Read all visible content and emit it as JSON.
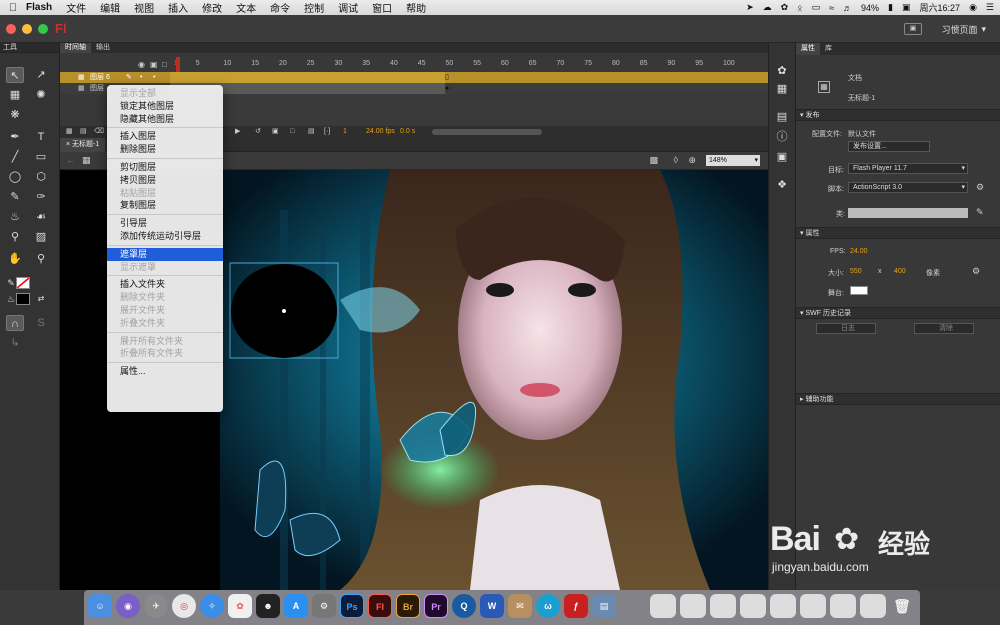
{
  "menubar": {
    "app_name": "Flash",
    "items": [
      "文件",
      "编辑",
      "视图",
      "插入",
      "修改",
      "文本",
      "命令",
      "控制",
      "调试",
      "窗口",
      "帮助"
    ],
    "battery": "94%",
    "clock": "周六16:27"
  },
  "titlebar": {
    "logo": "Fl",
    "workspace": "习惯页面"
  },
  "tools": {
    "header": "工具"
  },
  "timeline": {
    "tabs": [
      "时间轴",
      "输出"
    ],
    "ruler_labels": [
      "1",
      "5",
      "10",
      "15",
      "20",
      "25",
      "30",
      "35",
      "40",
      "45",
      "50",
      "55",
      "60",
      "65",
      "70",
      "75",
      "80",
      "85",
      "90",
      "95",
      "100"
    ],
    "layers": [
      {
        "name": "图层 6"
      },
      {
        "name": "图层"
      }
    ],
    "footer": {
      "frame": "1",
      "fps": "24.00 fps",
      "seconds": "0.0 s"
    }
  },
  "document": {
    "tab": "无标题-1",
    "zoom": "148%"
  },
  "context_menu": {
    "items": [
      {
        "label": "显示全部",
        "disabled": true
      },
      {
        "label": "锁定其他图层",
        "disabled": false
      },
      {
        "label": "隐藏其他图层",
        "disabled": false
      },
      {
        "sep": true
      },
      {
        "label": "插入图层",
        "disabled": false
      },
      {
        "label": "删除图层",
        "disabled": false
      },
      {
        "sep": true
      },
      {
        "label": "剪切图层",
        "disabled": false
      },
      {
        "label": "拷贝图层",
        "disabled": false
      },
      {
        "label": "粘贴图层",
        "disabled": true
      },
      {
        "label": "复制图层",
        "disabled": false
      },
      {
        "sep": true
      },
      {
        "label": "引导层",
        "disabled": false
      },
      {
        "label": "添加传统运动引导层",
        "disabled": false
      },
      {
        "sep": true
      },
      {
        "label": "遮罩层",
        "disabled": false,
        "highlight": true
      },
      {
        "label": "显示遮罩",
        "disabled": true
      },
      {
        "sep": true
      },
      {
        "label": "插入文件夹",
        "disabled": false
      },
      {
        "label": "删除文件夹",
        "disabled": true
      },
      {
        "label": "展开文件夹",
        "disabled": true
      },
      {
        "label": "折叠文件夹",
        "disabled": true
      },
      {
        "sep": true
      },
      {
        "label": "展开所有文件夹",
        "disabled": true
      },
      {
        "label": "折叠所有文件夹",
        "disabled": true
      },
      {
        "sep": true
      },
      {
        "label": "属性...",
        "disabled": false
      }
    ]
  },
  "properties": {
    "tabs": [
      "属性",
      "库"
    ],
    "doc_type": "文档",
    "doc_name": "无标题-1",
    "publish": {
      "section": "发布",
      "profile_label": "配置文件:",
      "profile_value": "默认文件",
      "settings_button": "发布设置...",
      "target_label": "目标:",
      "target_value": "Flash Player 11.7",
      "script_label": "脚本:",
      "script_value": "ActionScript 3.0",
      "class_label": "类:"
    },
    "attributes": {
      "section": "属性",
      "fps_label": "FPS:",
      "fps_value": "24.00",
      "size_label": "大小:",
      "width": "550",
      "x": "x",
      "height": "400",
      "unit": "像素",
      "stage_label": "舞台:"
    },
    "swf_history": {
      "section": "SWF 历史记录",
      "log_button": "日志",
      "clear_button": "清除"
    },
    "accessibility": {
      "section": "辅助功能"
    }
  },
  "watermark": {
    "brand": "Bai",
    "brand2": "经验",
    "url": "jingyan.baidu.com"
  },
  "dock": {
    "labels": [
      "Ps",
      "Fl",
      "Br",
      "Pr",
      "W"
    ]
  },
  "colors": {
    "highlight": "#1f5ed8",
    "layer_selected": "#b8902a",
    "accent_orange": "#e3a21a",
    "flash_red": "#c8312a"
  }
}
